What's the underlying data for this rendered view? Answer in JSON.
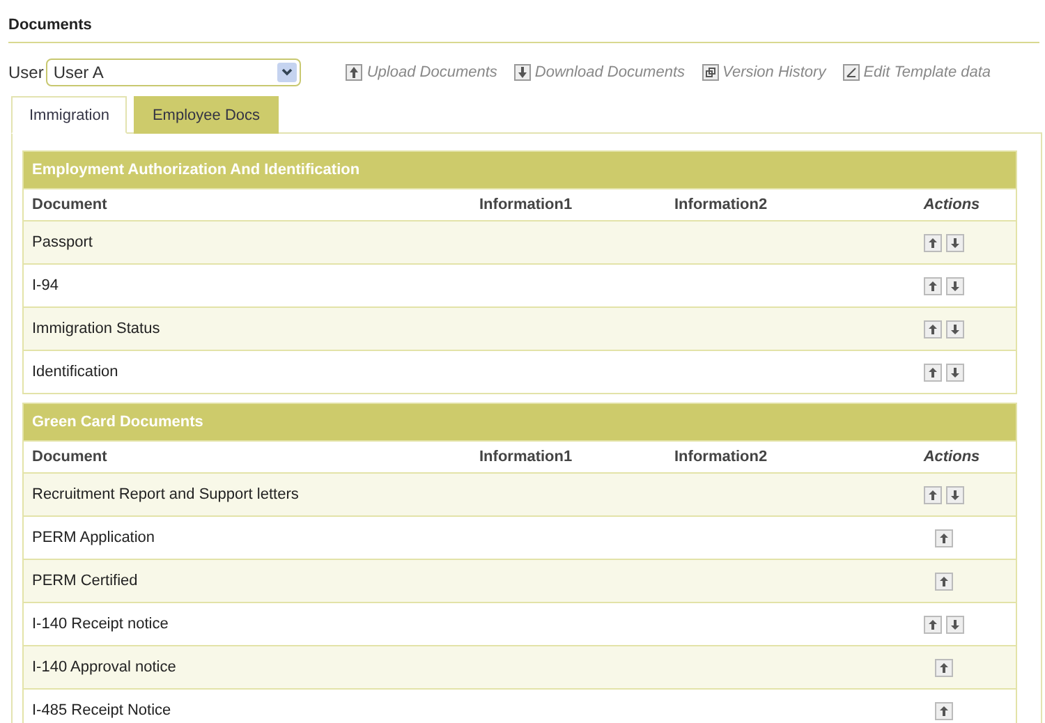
{
  "title": "Documents",
  "user_select": {
    "label": "User",
    "value": "User A"
  },
  "toolbar": [
    {
      "kind": "upload",
      "label": "Upload Documents"
    },
    {
      "kind": "download",
      "label": "Download Documents"
    },
    {
      "kind": "history",
      "label": "Version History"
    },
    {
      "kind": "edit",
      "label": "Edit Template data"
    }
  ],
  "tabs": [
    {
      "label": "Immigration",
      "selected": true
    },
    {
      "label": "Employee Docs",
      "selected": false
    }
  ],
  "sections": [
    {
      "title": "Employment Authorization And Identification",
      "columns": [
        "Document",
        "Information1",
        "Information2",
        "Actions"
      ],
      "rows": [
        {
          "document": "Passport",
          "download": true
        },
        {
          "document": "I-94",
          "download": true
        },
        {
          "document": "Immigration Status",
          "download": true
        },
        {
          "document": "Identification",
          "download": true
        }
      ]
    },
    {
      "title": "Green Card Documents",
      "columns": [
        "Document",
        "Information1",
        "Information2",
        "Actions"
      ],
      "rows": [
        {
          "document": "Recruitment Report and Support letters",
          "download": true
        },
        {
          "document": "PERM Application",
          "download": false
        },
        {
          "document": "PERM Certified",
          "download": false
        },
        {
          "document": "I-140 Receipt notice",
          "download": true
        },
        {
          "document": "I-140 Approval notice",
          "download": false
        },
        {
          "document": "I-485 Receipt Notice",
          "download": false
        }
      ]
    }
  ]
}
